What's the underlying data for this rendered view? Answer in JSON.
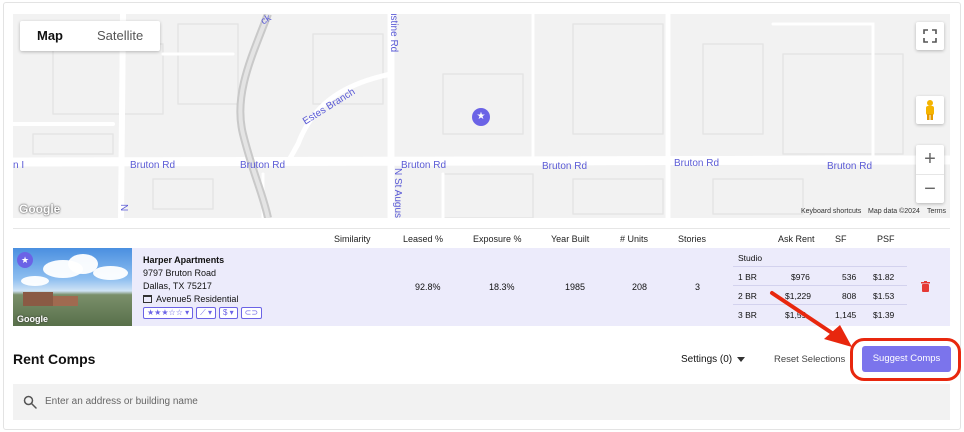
{
  "map": {
    "toggle": {
      "map": "Map",
      "satellite": "Satellite"
    },
    "road_labels": {
      "bruton_1": "Bruton Rd",
      "bruton_2": "Bruton Rd",
      "bruton_3": "Bruton Rd",
      "bruton_4": "Bruton Rd",
      "bruton_5": "Bruton Rd",
      "bruton_6": "Bruton Rd",
      "bruton_left": "n I",
      "estes": "Estes Branch",
      "augustine": "ustine Rd",
      "n_st_augus": "N St Augus",
      "n_left": "N",
      "ck": "ck"
    },
    "marker_icon": "star-icon",
    "logo": "Google",
    "footer": {
      "shortcuts": "Keyboard shortcuts",
      "data": "Map data ©2024",
      "terms": "Terms"
    },
    "icons": {
      "fullscreen": "fullscreen-icon",
      "pegman": "pegman-icon",
      "zoom_in": "+",
      "zoom_out": "−"
    }
  },
  "table": {
    "headers": {
      "similarity": "Similarity",
      "leased": "Leased %",
      "exposure": "Exposure %",
      "year_built": "Year Built",
      "units": "# Units",
      "stories": "Stories",
      "ask_rent": "Ask Rent",
      "sf": "SF",
      "psf": "PSF"
    },
    "property": {
      "name": "Harper Apartments",
      "street": "9797 Bruton Road",
      "city": "Dallas, TX 75217",
      "management": "Avenue5 Residential",
      "rating_stars": "★★★☆☆",
      "rating_filled": 3,
      "photo_logo": "Google",
      "leased": "92.8%",
      "exposure": "18.3%",
      "year_built": "1985",
      "units": "208",
      "stories": "3",
      "unit_mix": [
        {
          "type": "Studio",
          "rent": "",
          "sf": "",
          "psf": ""
        },
        {
          "type": "1 BR",
          "rent": "$976",
          "sf": "536",
          "psf": "$1.82"
        },
        {
          "type": "2 BR",
          "rent": "$1,229",
          "sf": "808",
          "psf": "$1.53"
        },
        {
          "type": "3 BR",
          "rent": "$1,59",
          "sf": "1,145",
          "psf": "$1.39"
        }
      ]
    }
  },
  "rent_comps": {
    "title": "Rent Comps",
    "settings_label": "Settings (0)",
    "reset_label": "Reset Selections",
    "suggest_label": "Suggest Comps",
    "search_placeholder": "Enter an address or building name"
  },
  "colors": {
    "accent": "#7b74ec",
    "highlight": "#e8270e",
    "row_bg": "#ecebfb",
    "delete": "#e53935"
  }
}
